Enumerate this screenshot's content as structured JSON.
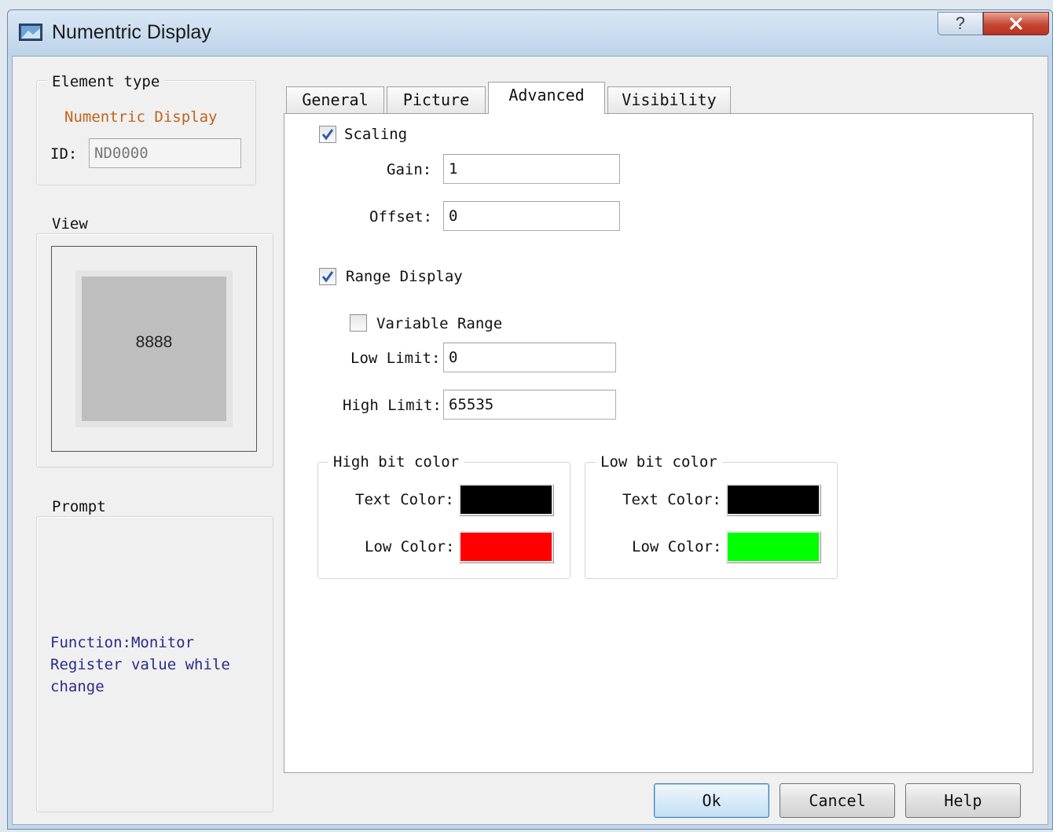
{
  "window": {
    "title": "Numentric Display",
    "help_glyph": "?"
  },
  "element_type": {
    "group_label": "Element type",
    "name": "Numentric Display",
    "id_label": "ID:",
    "id_value": "ND0000"
  },
  "view": {
    "group_label": "View",
    "preview_text": "8888"
  },
  "prompt": {
    "group_label": "Prompt",
    "lines": [
      "Function:Monitor",
      "Register value while",
      "change"
    ]
  },
  "tabs": [
    "General",
    "Picture",
    "Advanced",
    "Visibility"
  ],
  "active_tab": "Advanced",
  "advanced": {
    "scaling": {
      "label": "Scaling",
      "checked": true,
      "gain_label": "Gain:",
      "gain": "1",
      "offset_label": "Offset:",
      "offset": "0"
    },
    "range": {
      "label": "Range Display",
      "checked": true,
      "variable_label": "Variable Range",
      "variable_checked": false,
      "low_label": "Low Limit:",
      "low": "0",
      "high_label": "High Limit:",
      "high": "65535"
    },
    "high_bit": {
      "label": "High bit color",
      "text_label": "Text Color:",
      "text_color": "#000000",
      "low_label": "Low Color:",
      "low_color": "#ff0000"
    },
    "low_bit": {
      "label": "Low bit color",
      "text_label": "Text Color:",
      "text_color": "#000000",
      "low_label": "Low Color:",
      "low_color": "#00ff00"
    }
  },
  "buttons": {
    "ok": "Ok",
    "cancel": "Cancel",
    "help": "Help"
  }
}
